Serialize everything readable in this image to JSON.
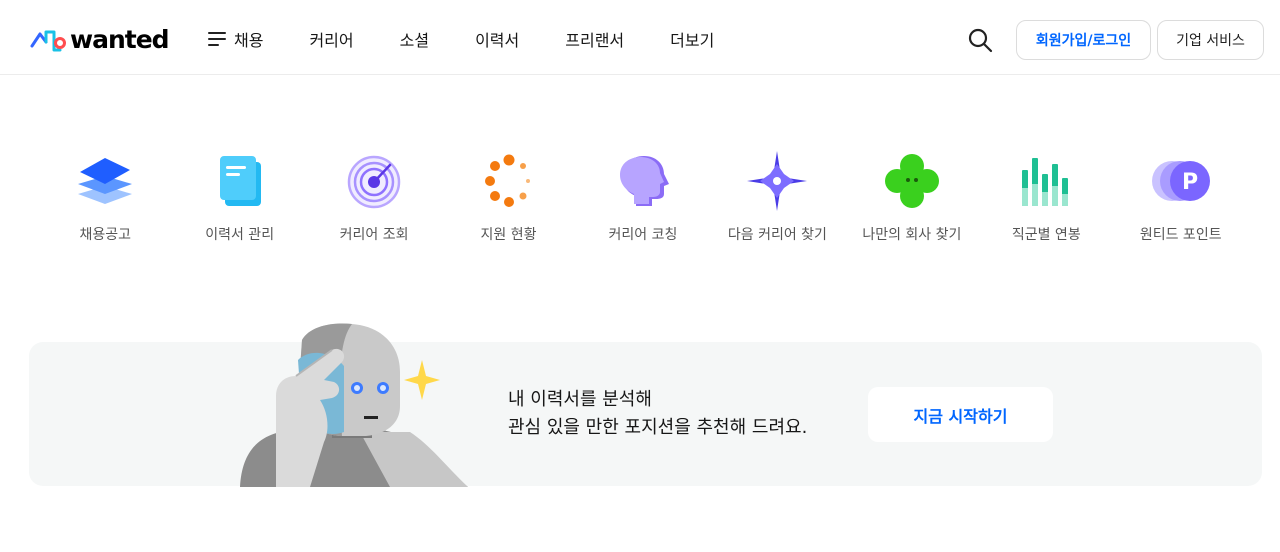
{
  "header": {
    "logo_text": "wanted",
    "menu_label": "채용",
    "nav": [
      "커리어",
      "소셜",
      "이력서",
      "프리랜서",
      "더보기"
    ],
    "login_label": "회원가입/로그인",
    "business_label": "기업 서비스"
  },
  "shortcuts": [
    {
      "label": "채용공고",
      "icon": "stacked-layers-icon"
    },
    {
      "label": "이력서 관리",
      "icon": "document-icon"
    },
    {
      "label": "커리어 조회",
      "icon": "target-icon"
    },
    {
      "label": "지원 현황",
      "icon": "loading-dots-icon"
    },
    {
      "label": "커리어 코칭",
      "icon": "head-profile-icon"
    },
    {
      "label": "다음 커리어 찾기",
      "icon": "compass-star-icon"
    },
    {
      "label": "나만의 회사 찾기",
      "icon": "clover-icon"
    },
    {
      "label": "직군별 연봉",
      "icon": "bar-chart-icon"
    },
    {
      "label": "원티드 포인트",
      "icon": "point-coin-icon"
    }
  ],
  "banner": {
    "line1": "내 이력서를 분석해",
    "line2": "관심 있을 만한 포지션을 추천해 드려요.",
    "button_label": "지금 시작하기"
  },
  "colors": {
    "accent": "#0066ff",
    "banner_bg": "#f5f7f7"
  }
}
